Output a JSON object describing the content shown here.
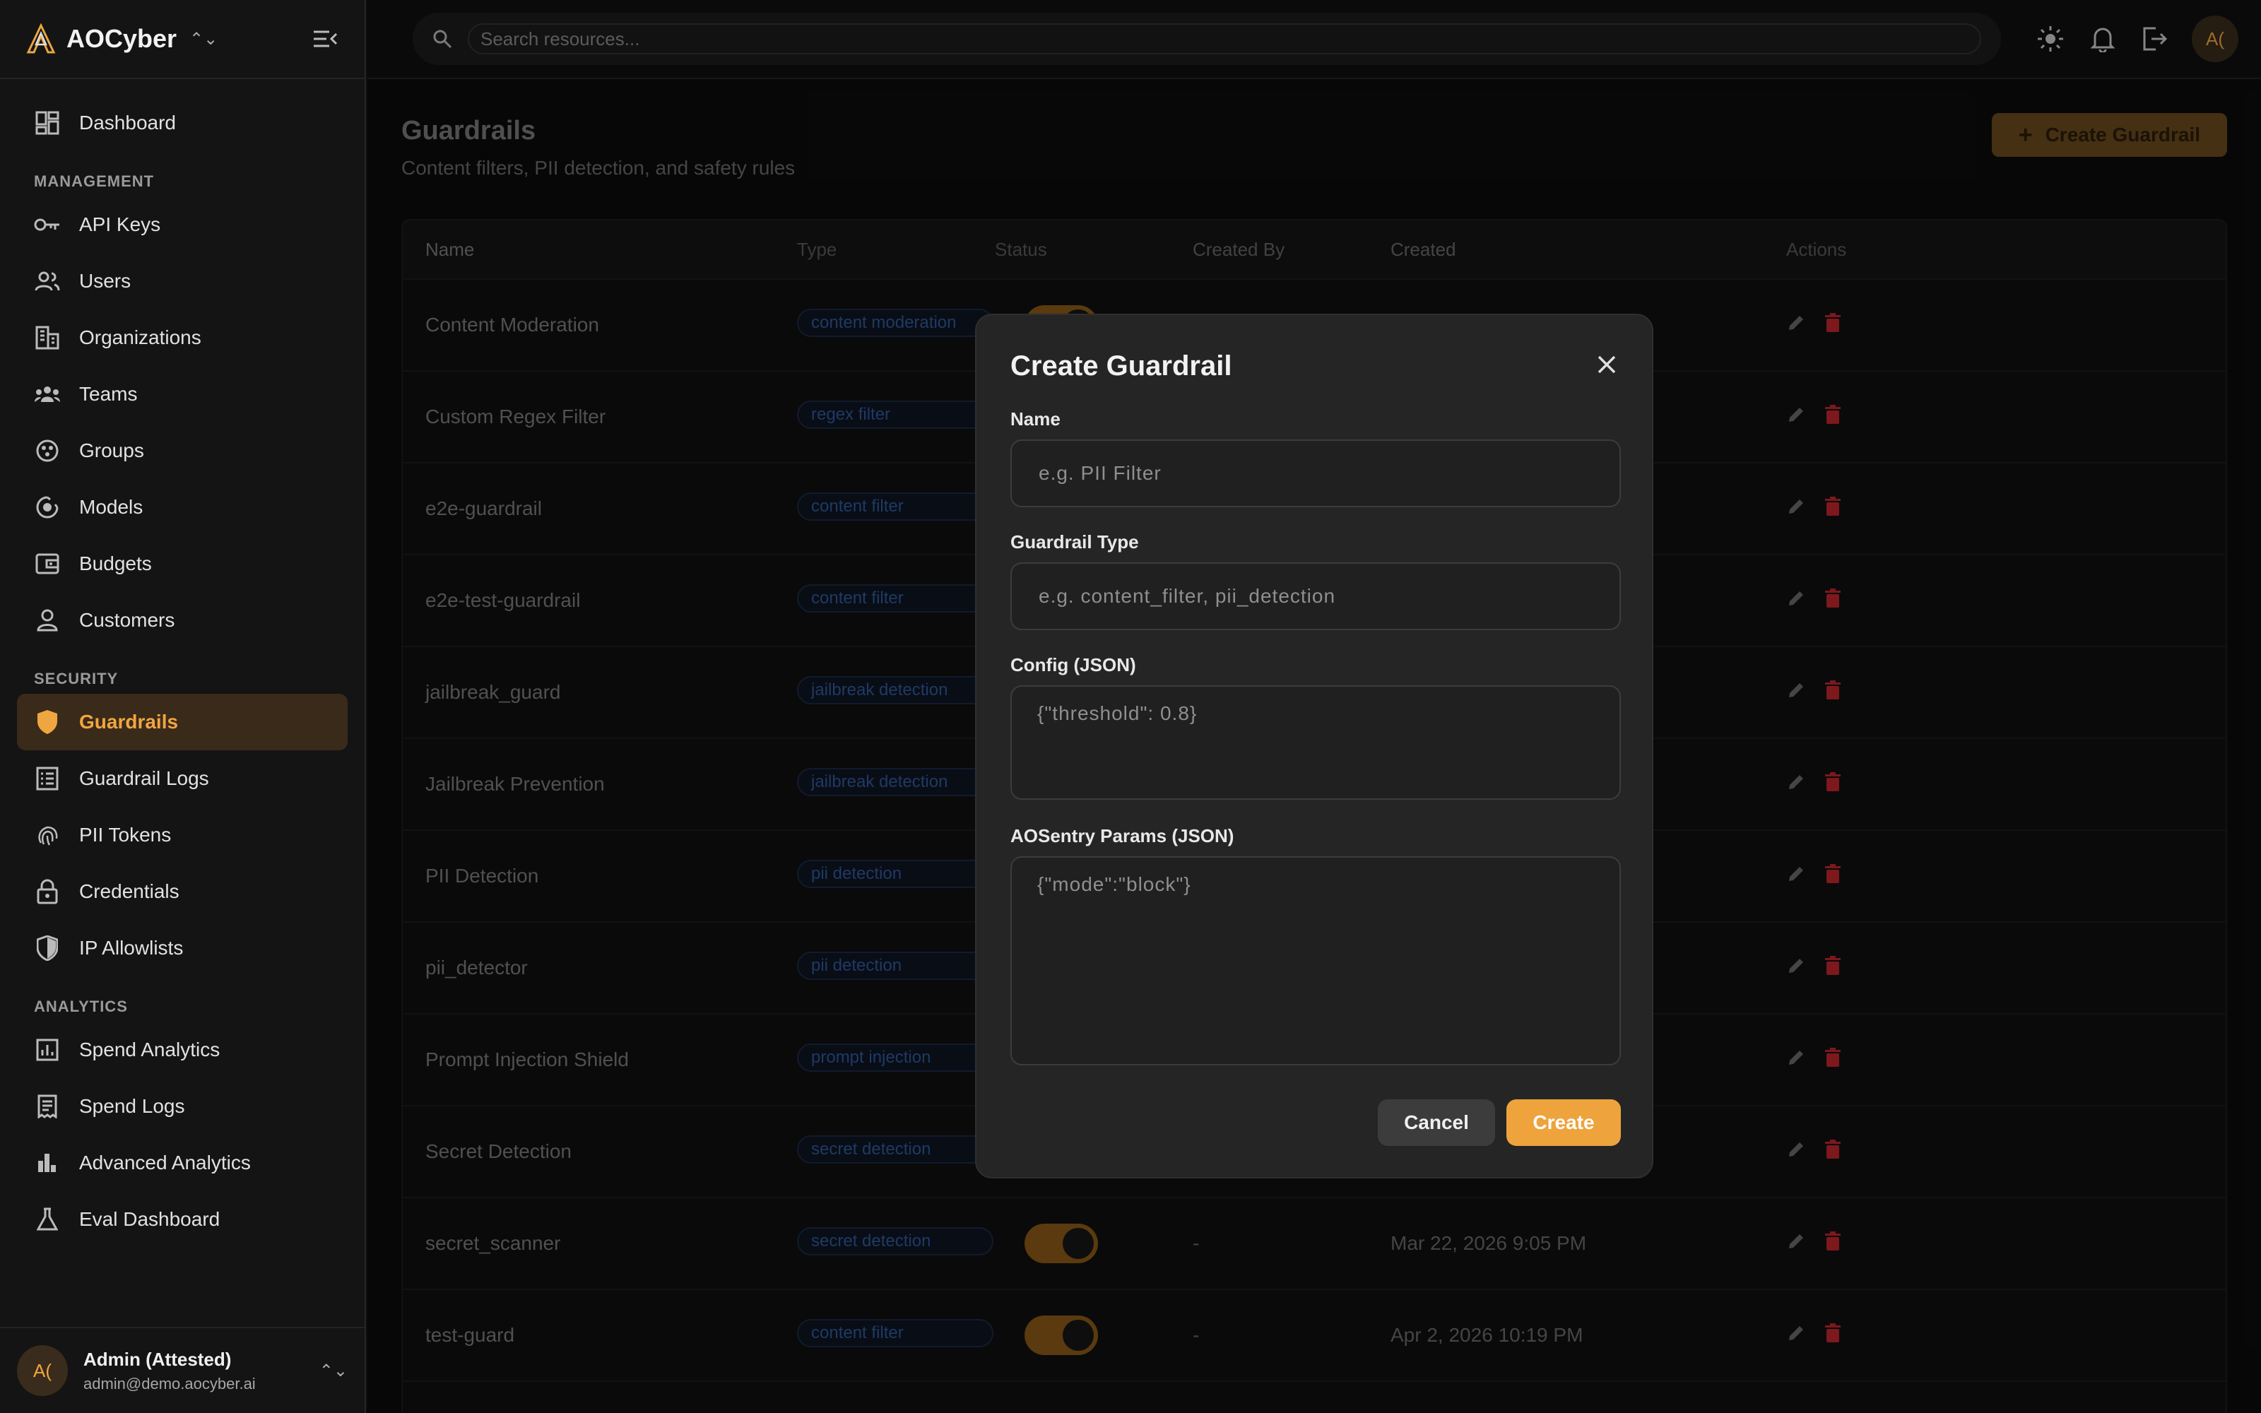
{
  "brand": {
    "name": "AOCyber"
  },
  "sidebar": {
    "top_items": [
      {
        "label": "Dashboard",
        "icon": "dashboard-icon"
      }
    ],
    "management_label": "MANAGEMENT",
    "management": [
      {
        "label": "API Keys",
        "icon": "key-icon"
      },
      {
        "label": "Users",
        "icon": "users-icon"
      },
      {
        "label": "Organizations",
        "icon": "building-icon"
      },
      {
        "label": "Teams",
        "icon": "team-icon"
      },
      {
        "label": "Groups",
        "icon": "groups-icon"
      },
      {
        "label": "Models",
        "icon": "models-icon"
      },
      {
        "label": "Budgets",
        "icon": "wallet-icon"
      },
      {
        "label": "Customers",
        "icon": "person-icon"
      }
    ],
    "security_label": "SECURITY",
    "security": [
      {
        "label": "Guardrails",
        "icon": "shield-icon",
        "active": true
      },
      {
        "label": "Guardrail Logs",
        "icon": "list-icon"
      },
      {
        "label": "PII Tokens",
        "icon": "fingerprint-icon"
      },
      {
        "label": "Credentials",
        "icon": "lock-icon"
      },
      {
        "label": "IP Allowlists",
        "icon": "shield-check-icon"
      }
    ],
    "analytics_label": "ANALYTICS",
    "analytics": [
      {
        "label": "Spend Analytics",
        "icon": "chart-icon"
      },
      {
        "label": "Spend Logs",
        "icon": "receipt-icon"
      },
      {
        "label": "Advanced Analytics",
        "icon": "bar-chart-icon"
      },
      {
        "label": "Eval Dashboard",
        "icon": "flask-icon"
      }
    ],
    "user": {
      "initials": "A(",
      "name": "Admin (Attested)",
      "email": "admin@demo.aocyber.ai"
    }
  },
  "topbar": {
    "search_placeholder": "Search resources...",
    "avatar_initials": "A("
  },
  "page": {
    "title": "Guardrails",
    "subtitle": "Content filters, PII detection, and safety rules",
    "create_button": "Create Guardrail"
  },
  "table": {
    "columns": [
      "Name",
      "Type",
      "Status",
      "Created By",
      "Created",
      "Actions"
    ],
    "rows": [
      {
        "name": "Content Moderation",
        "type": "content moderation",
        "by": "",
        "created": ""
      },
      {
        "name": "Custom Regex Filter",
        "type": "regex filter",
        "by": "",
        "created": ""
      },
      {
        "name": "e2e-guardrail",
        "type": "content filter",
        "by": "",
        "created": ""
      },
      {
        "name": "e2e-test-guardrail",
        "type": "content filter",
        "by": "",
        "created": ""
      },
      {
        "name": "jailbreak_guard",
        "type": "jailbreak detection",
        "by": "",
        "created": ""
      },
      {
        "name": "Jailbreak Prevention",
        "type": "jailbreak detection",
        "by": "",
        "created": ""
      },
      {
        "name": "PII Detection",
        "type": "pii detection",
        "by": "",
        "created": ""
      },
      {
        "name": "pii_detector",
        "type": "pii detection",
        "by": "",
        "created": ""
      },
      {
        "name": "Prompt Injection Shield",
        "type": "prompt injection",
        "by": "",
        "created": ""
      },
      {
        "name": "Secret Detection",
        "type": "secret detection",
        "by": "",
        "created": ""
      },
      {
        "name": "secret_scanner",
        "type": "secret detection",
        "by": "-",
        "created": "Mar 22, 2026 9:05 PM"
      },
      {
        "name": "test-guard",
        "type": "content filter",
        "by": "-",
        "created": "Apr 2, 2026 10:19 PM"
      }
    ]
  },
  "modal": {
    "title": "Create Guardrail",
    "name_label": "Name",
    "name_placeholder": "e.g. PII Filter",
    "type_label": "Guardrail Type",
    "type_placeholder": "e.g. content_filter, pii_detection",
    "config_label": "Config (JSON)",
    "config_placeholder": "{\"threshold\": 0.8}",
    "params_label": "AOSentry Params (JSON)",
    "params_placeholder": "{\"mode\":\"block\"}",
    "cancel": "Cancel",
    "create": "Create"
  },
  "colors": {
    "accent": "#eea33c",
    "active_bg": "#3a2a1a",
    "delete": "#c0262d"
  }
}
